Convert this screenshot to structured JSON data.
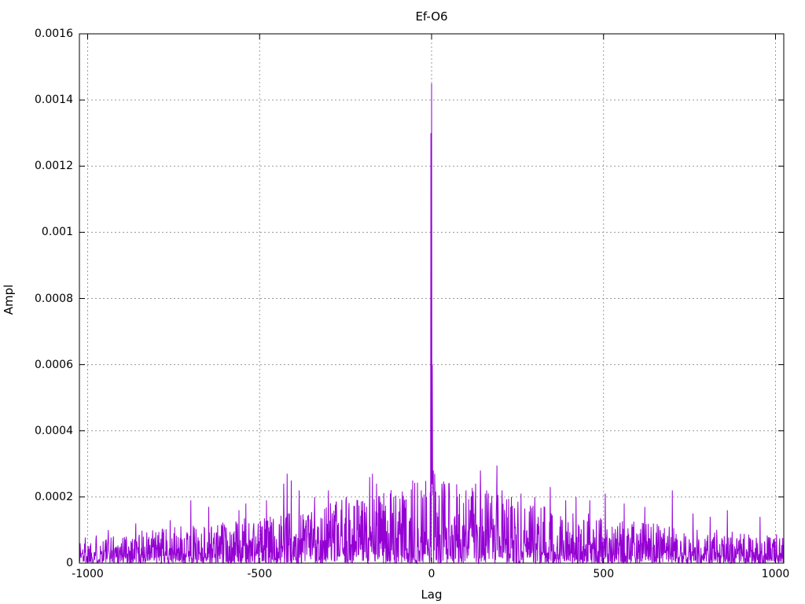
{
  "chart_data": {
    "type": "line",
    "title": "Ef-O6",
    "xlabel": "Lag",
    "ylabel": "Ampl",
    "xlim": [
      -1024,
      1024
    ],
    "ylim": [
      0,
      0.0016
    ],
    "x_ticks": [
      {
        "v": -1000,
        "label": "-1000"
      },
      {
        "v": -500,
        "label": "-500"
      },
      {
        "v": 0,
        "label": "0"
      },
      {
        "v": 500,
        "label": "500"
      },
      {
        "v": 1000,
        "label": "1000"
      }
    ],
    "y_ticks": [
      {
        "v": 0,
        "label": "0"
      },
      {
        "v": 0.0002,
        "label": "0.0002"
      },
      {
        "v": 0.0004,
        "label": "0.0004"
      },
      {
        "v": 0.0006,
        "label": "0.0006"
      },
      {
        "v": 0.0008,
        "label": "0.0008"
      },
      {
        "v": 0.001,
        "label": "0.001"
      },
      {
        "v": 0.0012,
        "label": "0.0012"
      },
      {
        "v": 0.0014,
        "label": "0.0014"
      },
      {
        "v": 0.0016,
        "label": "0.0016"
      }
    ],
    "grid": "dotted",
    "grid_color": "#9a9a9a",
    "border_color": "#000000",
    "legend": "none",
    "series": [
      {
        "name": "Ef-O6",
        "color": "#9400D3",
        "style": "noisy positive amplitude vs lag, impulse-like line plot",
        "main_peak": {
          "lag": 0,
          "ampl": 0.00145
        },
        "center_cluster": [
          [
            -2,
            0.0013
          ],
          [
            0,
            0.00145
          ],
          [
            2,
            0.0006
          ],
          [
            3,
            0.00028
          ]
        ],
        "notable_peaks": [
          [
            -940,
            0.0001
          ],
          [
            -860,
            0.00012
          ],
          [
            -760,
            0.00013
          ],
          [
            -700,
            0.00019
          ],
          [
            -648,
            0.00017
          ],
          [
            -560,
            0.00016
          ],
          [
            -540,
            0.00018
          ],
          [
            -480,
            0.00019
          ],
          [
            -430,
            0.00024
          ],
          [
            -420,
            0.00027
          ],
          [
            -408,
            0.00025
          ],
          [
            -385,
            0.00022
          ],
          [
            -340,
            0.0002
          ],
          [
            -300,
            0.00022
          ],
          [
            -248,
            0.0002
          ],
          [
            -215,
            0.00019
          ],
          [
            -180,
            0.00026
          ],
          [
            -172,
            0.00027
          ],
          [
            -160,
            0.00024
          ],
          [
            -120,
            0.00021
          ],
          [
            -110,
            0.0002
          ],
          [
            -75,
            0.00019
          ],
          [
            -55,
            0.00025
          ],
          [
            -30,
            0.00022
          ],
          [
            -15,
            0.0002
          ],
          [
            5,
            0.00028
          ],
          [
            9,
            0.00027
          ],
          [
            30,
            0.00024
          ],
          [
            50,
            0.00024
          ],
          [
            75,
            0.0002
          ],
          [
            100,
            0.00022
          ],
          [
            128,
            0.00024
          ],
          [
            142,
            0.00028
          ],
          [
            160,
            0.00022
          ],
          [
            190,
            0.000295
          ],
          [
            205,
            0.00022
          ],
          [
            232,
            0.0002
          ],
          [
            260,
            0.00021
          ],
          [
            300,
            0.0002
          ],
          [
            345,
            0.00023
          ],
          [
            390,
            0.00019
          ],
          [
            420,
            0.0002
          ],
          [
            460,
            0.00019
          ],
          [
            505,
            0.00021
          ],
          [
            560,
            0.00018
          ],
          [
            620,
            0.00017
          ],
          [
            700,
            0.00022
          ],
          [
            760,
            0.00015
          ],
          [
            810,
            0.00014
          ],
          [
            860,
            0.00016
          ],
          [
            955,
            0.00014
          ]
        ],
        "noise_model": {
          "seed": 1337,
          "lag_start": -1024,
          "n_points": 2048,
          "floor": 4e-05,
          "center_boost": 0.00012,
          "decay_scale": 550,
          "decay_power": 1.2,
          "spike_exponent": 1.8,
          "spike_gain": 1.6
        }
      }
    ]
  }
}
